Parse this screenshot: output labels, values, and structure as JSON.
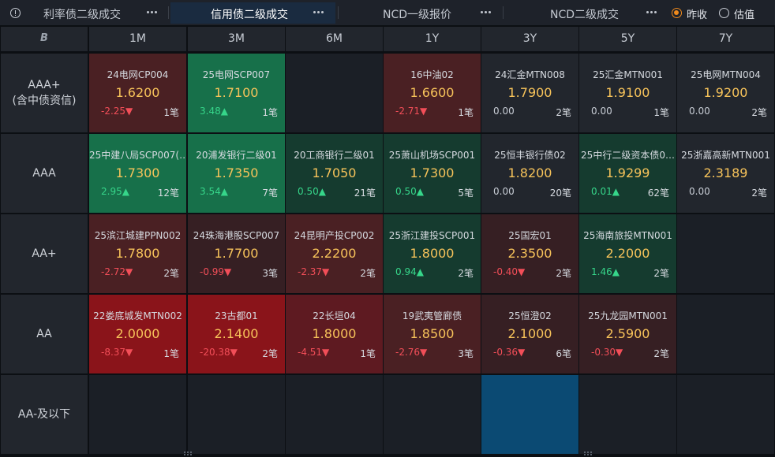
{
  "tabs": [
    {
      "label": "利率债二级成交",
      "active": false
    },
    {
      "label": "信用债二级成交",
      "active": true
    },
    {
      "label": "NCD一级报价",
      "active": false
    },
    {
      "label": "NCD二级成交",
      "active": false
    }
  ],
  "radio": [
    {
      "label": "昨收",
      "checked": true
    },
    {
      "label": "估值",
      "checked": false
    }
  ],
  "corner_icon": "B",
  "columns": [
    "1M",
    "3M",
    "6M",
    "1Y",
    "3Y",
    "5Y",
    "7Y"
  ],
  "rows": [
    {
      "label": "AAA+\n(含中债资信)",
      "cells": [
        {
          "name": "24电网CP004",
          "yield": "1.6200",
          "chg": "-2.25▼",
          "dir": "down",
          "count": "1笔",
          "tone": "red"
        },
        {
          "name": "25电网SCP007",
          "yield": "1.7100",
          "chg": "3.48▲",
          "dir": "up",
          "count": "1笔",
          "tone": "green"
        },
        null,
        {
          "name": "16中油02",
          "yield": "1.6600",
          "chg": "-2.71▼",
          "dir": "down",
          "count": "1笔",
          "tone": "red"
        },
        {
          "name": "24汇金MTN008",
          "yield": "1.7900",
          "chg": "0.00",
          "dir": "flat",
          "count": "2笔",
          "tone": "neu"
        },
        {
          "name": "25汇金MTN001",
          "yield": "1.9100",
          "chg": "0.00",
          "dir": "flat",
          "count": "1笔",
          "tone": "neu"
        },
        {
          "name": "25电网MTN004",
          "yield": "1.9200",
          "chg": "0.00",
          "dir": "flat",
          "count": "2笔",
          "tone": "neu"
        }
      ]
    },
    {
      "label": "AAA",
      "cells": [
        {
          "name": "25中建八局SCP007(…",
          "yield": "1.7300",
          "chg": "2.95▲",
          "dir": "up",
          "count": "12笔",
          "tone": "green"
        },
        {
          "name": "20浦发银行二级01",
          "yield": "1.7350",
          "chg": "3.54▲",
          "dir": "up",
          "count": "7笔",
          "tone": "green"
        },
        {
          "name": "20工商银行二级01",
          "yield": "1.7050",
          "chg": "0.50▲",
          "dir": "up",
          "count": "21笔",
          "tone": "lgreen"
        },
        {
          "name": "25萧山机场SCP001",
          "yield": "1.7300",
          "chg": "0.50▲",
          "dir": "up",
          "count": "5笔",
          "tone": "lgreen"
        },
        {
          "name": "25恒丰银行债02",
          "yield": "1.8200",
          "chg": "0.00",
          "dir": "flat",
          "count": "20笔",
          "tone": "neu"
        },
        {
          "name": "25中行二级资本债0…",
          "yield": "1.9299",
          "chg": "0.01▲",
          "dir": "up",
          "count": "62笔",
          "tone": "lgreen"
        },
        {
          "name": "25浙嘉高新MTN001",
          "yield": "2.3189",
          "chg": "0.00",
          "dir": "flat",
          "count": "2笔",
          "tone": "neu"
        }
      ]
    },
    {
      "label": "AA+",
      "cells": [
        {
          "name": "25滨江城建PPN002",
          "yield": "1.7800",
          "chg": "-2.72▼",
          "dir": "down",
          "count": "2笔",
          "tone": "red"
        },
        {
          "name": "24珠海港股SCP007",
          "yield": "1.7700",
          "chg": "-0.99▼",
          "dir": "down",
          "count": "3笔",
          "tone": "lred"
        },
        {
          "name": "24昆明产投CP002",
          "yield": "2.2200",
          "chg": "-2.37▼",
          "dir": "down",
          "count": "2笔",
          "tone": "red"
        },
        {
          "name": "25浙江建投SCP001",
          "yield": "1.8000",
          "chg": "0.94▲",
          "dir": "up",
          "count": "2笔",
          "tone": "lgreen"
        },
        {
          "name": "25国宏01",
          "yield": "2.3500",
          "chg": "-0.40▼",
          "dir": "down",
          "count": "2笔",
          "tone": "lred"
        },
        {
          "name": "25海南旅投MTN001",
          "yield": "2.2000",
          "chg": "1.46▲",
          "dir": "up",
          "count": "2笔",
          "tone": "lgreen"
        },
        null
      ]
    },
    {
      "label": "AA",
      "cells": [
        {
          "name": "22娄底城发MTN002",
          "yield": "2.0000",
          "chg": "-8.37▼",
          "dir": "down",
          "count": "1笔",
          "tone": "hot"
        },
        {
          "name": "23古都01",
          "yield": "2.1400",
          "chg": "-20.38▼",
          "dir": "down",
          "count": "2笔",
          "tone": "hot"
        },
        {
          "name": "22长垣04",
          "yield": "1.8000",
          "chg": "-4.51▼",
          "dir": "down",
          "count": "1笔",
          "tone": "mid"
        },
        {
          "name": "19武夷管廊债",
          "yield": "1.8500",
          "chg": "-2.76▼",
          "dir": "down",
          "count": "3笔",
          "tone": "red"
        },
        {
          "name": "25恒澄02",
          "yield": "2.1000",
          "chg": "-0.36▼",
          "dir": "down",
          "count": "6笔",
          "tone": "lred"
        },
        {
          "name": "25九龙园MTN001",
          "yield": "2.5900",
          "chg": "-0.30▼",
          "dir": "down",
          "count": "2笔",
          "tone": "lred"
        },
        null
      ]
    },
    {
      "label": "AA-及以下",
      "cells": [
        null,
        null,
        null,
        null,
        {
          "selected": true
        },
        null,
        null
      ]
    }
  ]
}
